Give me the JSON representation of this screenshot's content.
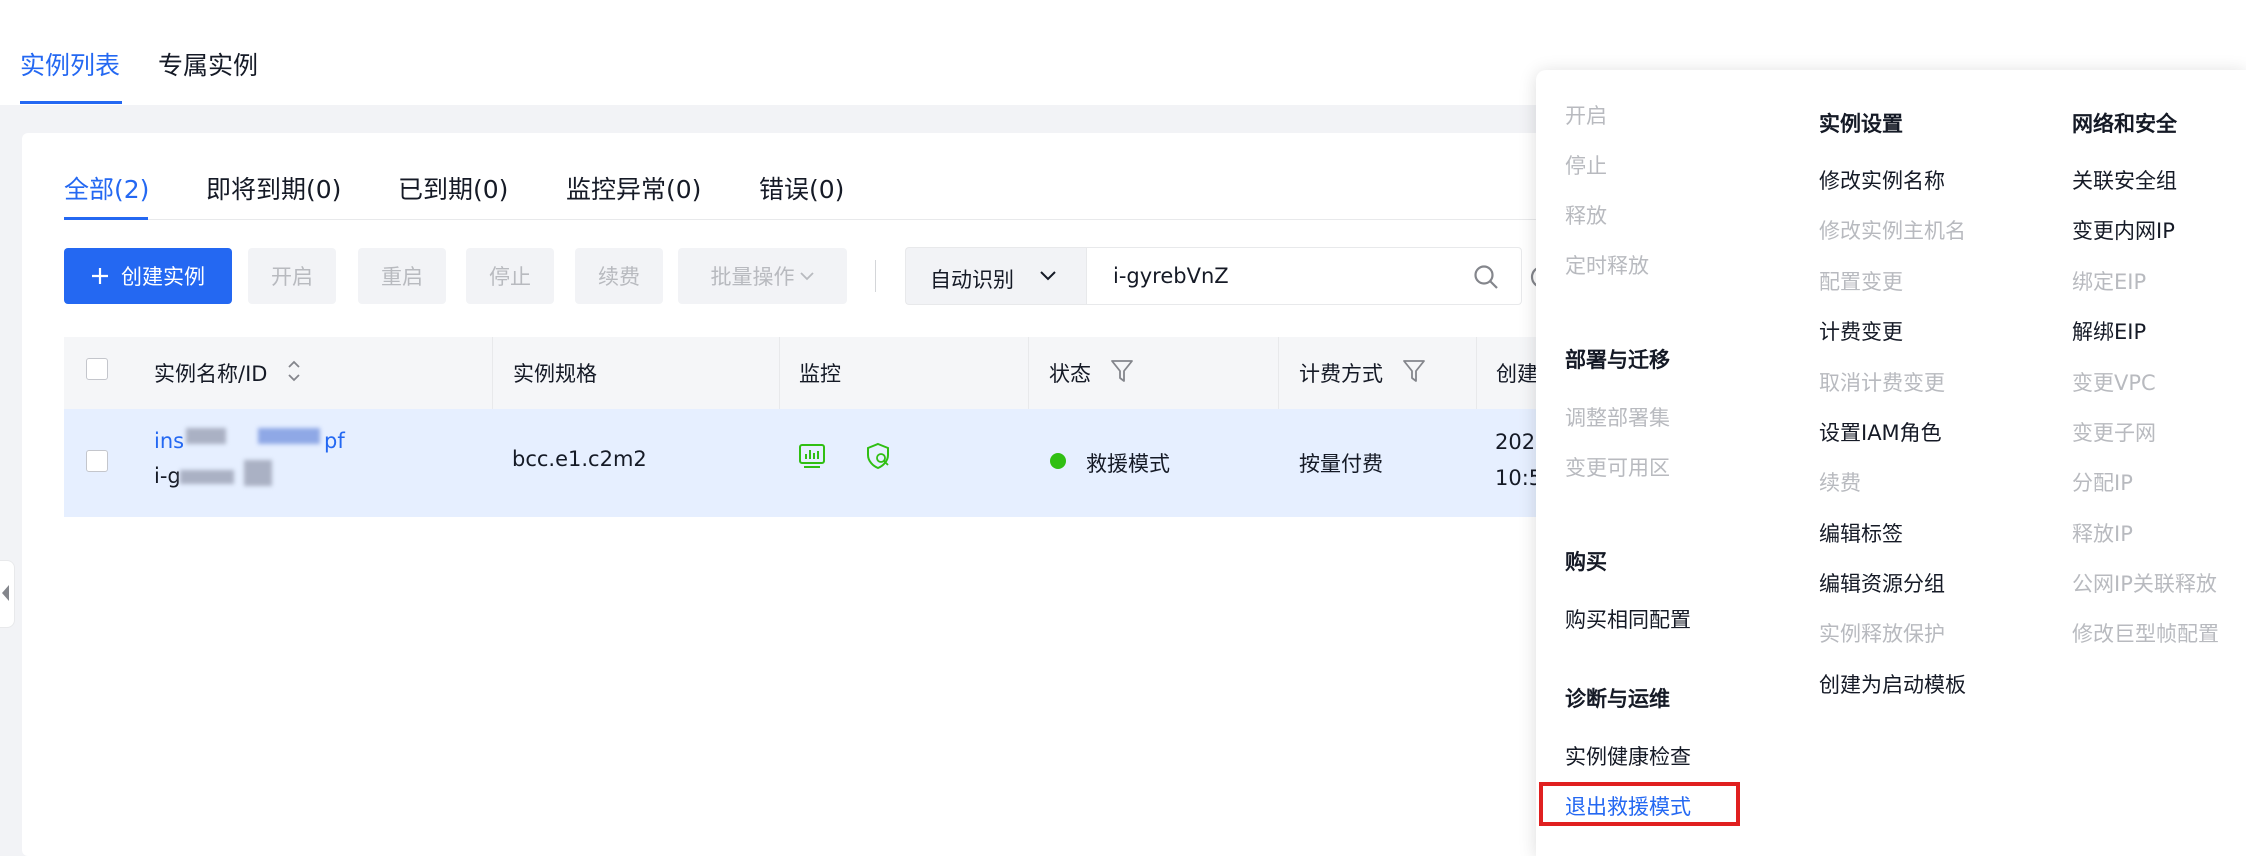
{
  "top_tabs": [
    "实例列表",
    "专属实例"
  ],
  "sub_tabs": [
    "全部(2)",
    "即将到期(0)",
    "已到期(0)",
    "监控异常(0)",
    "错误(0)"
  ],
  "toolbar": {
    "create_label": "创建实例",
    "start_label": "开启",
    "restart_label": "重启",
    "stop_label": "停止",
    "renew_label": "续费",
    "batch_label": "批量操作"
  },
  "search": {
    "select_label": "自动识别",
    "value": "i-gyrebVnZ"
  },
  "table": {
    "columns": [
      "实例名称/ID",
      "实例规格",
      "监控",
      "状态",
      "计费方式",
      "创建"
    ],
    "row": {
      "name_prefix": "ins",
      "name_suffix": "pf",
      "id_prefix": "i-g",
      "spec": "bcc.e1.c2m2",
      "status": "救援模式",
      "billing": "按量付费",
      "created_line1": "202",
      "created_line2": "10:5"
    }
  },
  "menu": {
    "col1": {
      "power": [
        "开启",
        "停止",
        "释放",
        "定时释放"
      ],
      "deploy_heading": "部署与迁移",
      "deploy": [
        "调整部署集",
        "变更可用区"
      ],
      "buy_heading": "购买",
      "buy": [
        "购买相同配置"
      ],
      "ops_heading": "诊断与运维",
      "ops": [
        "实例健康检查",
        "退出救援模式"
      ]
    },
    "col2": {
      "heading": "实例设置",
      "items": [
        "修改实例名称",
        "修改实例主机名",
        "配置变更",
        "计费变更",
        "取消计费变更",
        "设置IAM角色",
        "续费",
        "编辑标签",
        "编辑资源分组",
        "实例释放保护",
        "创建为启动模板"
      ]
    },
    "col3": {
      "heading": "网络和安全",
      "items": [
        "关联安全组",
        "变更内网IP",
        "绑定EIP",
        "解绑EIP",
        "变更VPC",
        "变更子网",
        "分配IP",
        "释放IP",
        "公网IP关联释放",
        "修改巨型帧配置"
      ]
    }
  },
  "colors": {
    "accent": "#2468f2",
    "status_green": "#30bf13",
    "highlight_red": "#e02020"
  }
}
